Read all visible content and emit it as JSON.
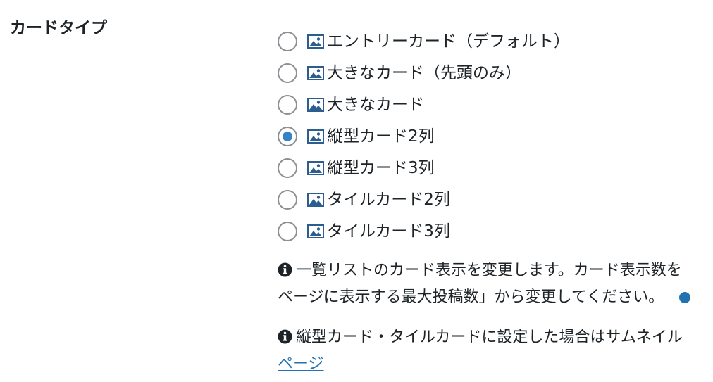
{
  "setting": {
    "label": "カードタイプ"
  },
  "icons": {
    "option_icon": "image-icon",
    "info_icon": "info-circle-icon",
    "radio_checked_color": "#3582c4",
    "link_color": "#2271b1"
  },
  "options": [
    {
      "label": "エントリーカード（デフォルト）",
      "checked": false
    },
    {
      "label": "大きなカード（先頭のみ）",
      "checked": false
    },
    {
      "label": "大きなカード",
      "checked": false
    },
    {
      "label": "縦型カード2列",
      "checked": true
    },
    {
      "label": "縦型カード3列",
      "checked": false
    },
    {
      "label": "タイルカード2列",
      "checked": false
    },
    {
      "label": "タイルカード3列",
      "checked": false
    }
  ],
  "descriptions": [
    {
      "line1": "一覧リストのカード表示を変更します。カード表示数を",
      "line2": "ページに表示する最大投稿数」から変更してください。"
    },
    {
      "line1": "縦型カード・タイルカードに設定した場合はサムネイル",
      "link": "ページ"
    }
  ]
}
